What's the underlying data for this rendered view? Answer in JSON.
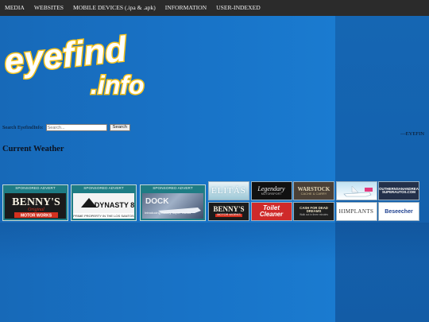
{
  "nav": {
    "items": [
      {
        "label": "MEDIA"
      },
      {
        "label": "WEBSITES"
      },
      {
        "label": "MOBILE DEVICES (.ipa & .apk)"
      },
      {
        "label": "INFORMATION"
      },
      {
        "label": "USER-INDEXED"
      }
    ]
  },
  "logo": {
    "word1": "eyefind",
    "word2": ".info"
  },
  "search": {
    "label": "Search EyefindInfo:",
    "placeholder": "Search...",
    "button": "Search"
  },
  "ticker": "—EYEFIN",
  "weather": {
    "title": "Current Weather"
  },
  "sponsored": [
    {
      "header": "SPONSORED ADVERT",
      "line1": "BENNY'S",
      "line2": "Original",
      "line3": "MOTOR WORKS"
    },
    {
      "header": "SPONSORED ADVERT",
      "line1": "DYNASTY 8",
      "caption": "PRIME PROPERTY IN THE LOS SANTOS AREA"
    },
    {
      "header": "SPONSORED ADVERT",
      "line1": "DOCK",
      "caption": "Introducing Galaxy Super Yachts"
    }
  ],
  "ads": {
    "elitas": "ELITÁS",
    "legendary": "Legendary",
    "legendary_sub": "MOTORSPORT",
    "warstock": "WARSTOCK",
    "warstock_sub": "CACHE & CARRY",
    "southern": "SOUTHERNSANANDREAS SUPERAUTOS.COM",
    "bennys": "BENNY'S",
    "bennys_sub": "MOTOR WORKS",
    "toilet1": "Toilet",
    "toilet2": "Cleaner",
    "cashdead": "CASH FOR DEAD DREAMS",
    "cashdead_sub": "Walk out in three minutes",
    "himplants": "HIMPLANTS",
    "bleeder": "Beseecher"
  },
  "colors": {
    "nav_bg": "#2b2b2b",
    "page_bg": "#1a72c4",
    "logo_yellow": "#f6c21a"
  }
}
